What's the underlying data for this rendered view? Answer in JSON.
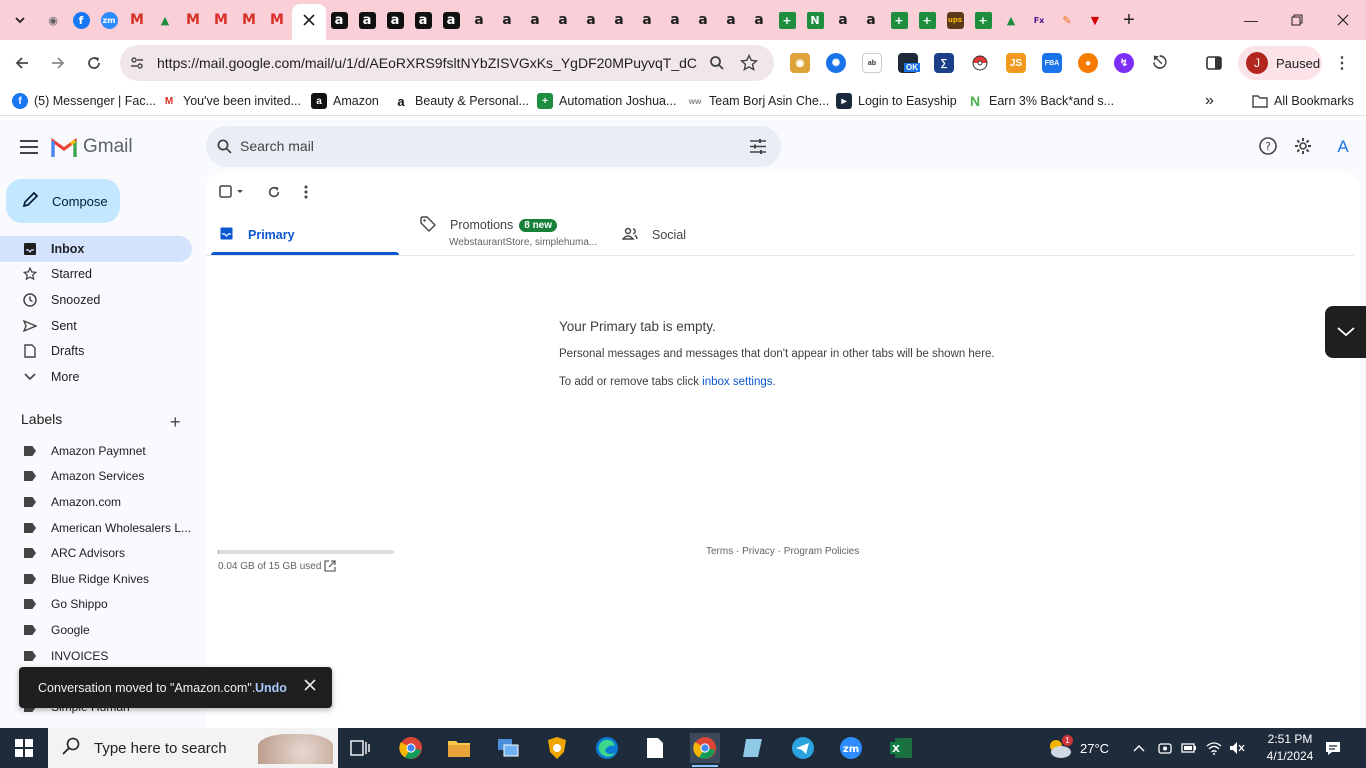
{
  "browser": {
    "url": "https://mail.google.com/mail/u/1/d/AEoRXRS9fsltNYbZISVGxKs_YgDF20MPuyvqT_dCS...",
    "profile_label": "Paused",
    "profile_initial": "J",
    "tab_favicons": [
      "chrome",
      "facebook",
      "zoom",
      "gmail",
      "drive",
      "gmail",
      "gmail",
      "gmail",
      "gmail",
      "gmail-active",
      "amazon",
      "amazon",
      "amazon",
      "amazon",
      "amazon",
      "amazon",
      "amazon",
      "amazon",
      "amazon",
      "amazon",
      "amazon",
      "amazon",
      "amazon",
      "amazon",
      "amazon",
      "amazon",
      "sheets",
      "wise",
      "amazon",
      "amazon",
      "sheets",
      "sheets",
      "ups",
      "sheets",
      "drive",
      "fedex",
      "pencil",
      "vpn"
    ],
    "new_tab_glyph": "+"
  },
  "bookmarks": [
    {
      "label": "(5) Messenger | Fac...",
      "icon": "facebook-icon"
    },
    {
      "label": "You've been invited...",
      "icon": "gmail-icon"
    },
    {
      "label": "Amazon",
      "icon": "amazon-icon"
    },
    {
      "label": "Beauty & Personal...",
      "icon": "amazon-icon"
    },
    {
      "label": "Automation Joshua...",
      "icon": "sheets-icon"
    },
    {
      "label": "Team Borj Asin Che...",
      "icon": "link-icon"
    },
    {
      "label": "Login to Easyship",
      "icon": "easyship-icon"
    },
    {
      "label": "Earn 3% Back*and s...",
      "icon": "rakuten-icon"
    }
  ],
  "bookmarks_all": "All Bookmarks",
  "gmail": {
    "brand": "Gmail",
    "search_placeholder": "Search mail",
    "account_initial": "A",
    "compose_label": "Compose",
    "nav": [
      {
        "label": "Inbox",
        "icon": "inbox-icon",
        "active": true
      },
      {
        "label": "Starred",
        "icon": "star-icon"
      },
      {
        "label": "Snoozed",
        "icon": "clock-icon"
      },
      {
        "label": "Sent",
        "icon": "send-icon"
      },
      {
        "label": "Drafts",
        "icon": "draft-icon"
      },
      {
        "label": "More",
        "icon": "chevron-down-icon"
      }
    ],
    "labels_heading": "Labels",
    "labels": [
      "Amazon Paymnet",
      "Amazon Services",
      "Amazon.com",
      "American Wholesalers L...",
      "ARC Advisors",
      "Blue Ridge Knives",
      "Go Shippo",
      "Google",
      "INVOICES",
      "Simple Human"
    ],
    "tabs": {
      "primary": "Primary",
      "promotions": "Promotions",
      "promotions_badge": "8 new",
      "promotions_sub": "WebstaurantStore, simplehuma...",
      "social": "Social"
    },
    "empty": {
      "title": "Your Primary tab is empty.",
      "desc": "Personal messages and messages that don't appear in other tabs will be shown here.",
      "settings_prefix": "To add or remove tabs click ",
      "settings_link": "inbox settings",
      "settings_suffix": "."
    },
    "storage": {
      "text": "0.04 GB of 15 GB used",
      "used_fraction": 0.003
    },
    "footer": "Terms · Privacy · Program Policies",
    "snackbar": {
      "message": "Conversation moved to \"Amazon.com\".",
      "action": "Undo"
    }
  },
  "taskbar": {
    "search_placeholder": "Type here to search",
    "weather_temp": "27°C",
    "weather_badge": "1",
    "time": "2:51 PM",
    "date": "4/1/2024"
  }
}
